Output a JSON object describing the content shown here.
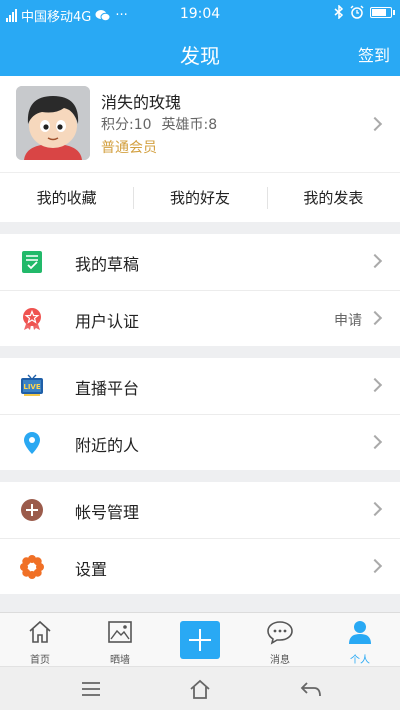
{
  "status_bar": {
    "carrier": "中国移动4G",
    "time": "19:04",
    "battery_level": 0.85
  },
  "header": {
    "title": "发现",
    "action": "签到"
  },
  "profile": {
    "name": "消失的玫瑰",
    "points": "积分:10",
    "coins": "英雄币:8",
    "level": "普通会员"
  },
  "quick_links": [
    "我的收藏",
    "我的好友",
    "我的发表"
  ],
  "groups": [
    {
      "items": [
        {
          "label": "我的草稿",
          "icon": "draft-icon",
          "value": ""
        },
        {
          "label": "用户认证",
          "icon": "verify-badge-icon",
          "value": "申请"
        }
      ]
    },
    {
      "items": [
        {
          "label": "直播平台",
          "icon": "live-tv-icon",
          "value": ""
        },
        {
          "label": "附近的人",
          "icon": "location-pin-icon",
          "value": ""
        }
      ]
    },
    {
      "items": [
        {
          "label": "帐号管理",
          "icon": "add-account-icon",
          "value": ""
        },
        {
          "label": "设置",
          "icon": "settings-flower-icon",
          "value": ""
        }
      ]
    }
  ],
  "tabbar": [
    "首页",
    "晒墙",
    "消息",
    "个人"
  ],
  "colors": {
    "accent": "#29a9f4",
    "member": "#d3a142"
  }
}
